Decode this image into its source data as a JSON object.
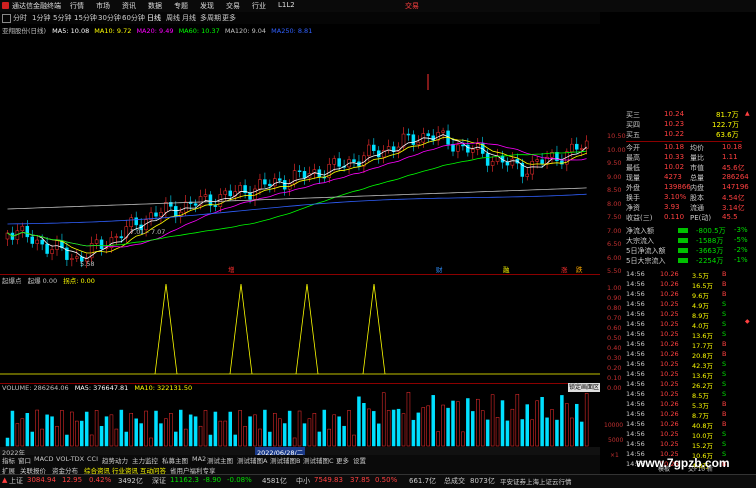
{
  "app": {
    "title": "通达信金融终端",
    "trade_label": "交易",
    "menu": [
      "行情",
      "市场",
      "资讯",
      "数据",
      "专题",
      "发现",
      "交易",
      "行业",
      "L1L2"
    ],
    "periods": [
      "分时",
      "1分钟",
      "5分钟",
      "15分钟",
      "30分钟",
      "60分钟",
      "日线",
      "周线",
      "月线",
      "多周期",
      "更多"
    ]
  },
  "stock": {
    "name_line": "亚翔股份(日线)",
    "ma": [
      {
        "label": "MA5: 10.08",
        "color": "#ffffff"
      },
      {
        "label": "MA10: 9.72",
        "color": "#ffff00"
      },
      {
        "label": "MA20: 9.49",
        "color": "#ff00ff"
      },
      {
        "label": "MA60: 10.37",
        "color": "#00ff00"
      },
      {
        "label": "MA120: 9.04",
        "color": "#c0c0c0"
      },
      {
        "label": "MA250: 8.81",
        "color": "#3060ff"
      }
    ],
    "low_price_label": "5.58",
    "range_label": "7.01 - 7.07"
  },
  "price_axis": [
    "10.50",
    "10.00",
    "9.50",
    "9.00",
    "8.50",
    "8.00",
    "7.50",
    "7.00",
    "6.50",
    "6.00",
    "5.50"
  ],
  "event_markers": [
    {
      "text": "增",
      "color": "#ff3030"
    },
    {
      "text": "财",
      "color": "#3090ff"
    },
    {
      "text": "融",
      "color": "#ffff00"
    },
    {
      "text": "涨",
      "color": "#ff3030"
    },
    {
      "text": "跌",
      "color": "#ffaa00"
    }
  ],
  "indicator": {
    "title": "起爆点",
    "title2": "起爆 0.00",
    "title3": "拐点: 0.00",
    "axis": [
      "1.00",
      "0.90",
      "0.80",
      "0.70",
      "0.60",
      "0.50",
      "0.40",
      "0.30",
      "0.20",
      "0.10",
      "0.00"
    ]
  },
  "volume": {
    "label": "VOLUME: 286264.06",
    "ma5": "MA5: 376647.81",
    "ma10": "MA10: 322131.50",
    "axis": [
      "10000",
      "5000",
      "×1"
    ],
    "lock_btn": "锁定画面区",
    "date_label": "2022年",
    "selected_date": "2022/06/28/二"
  },
  "bottom_tabs": [
    "指标",
    "窗口",
    "MACD",
    "VOL-TDX",
    "CCI",
    "趋势动力",
    "主力监控",
    "私募主图",
    "MA2",
    "测试主图",
    "测试辅图A",
    "测试辅图B",
    "测试辅图C",
    "更多",
    "设置"
  ],
  "bottom_tabs2": [
    "扩展",
    "关联报价",
    "资金分布",
    "综合资讯",
    "行业资讯",
    "互动问答",
    "省用户福利专享"
  ],
  "right_panel": {
    "order_rows": [
      {
        "label": "买三",
        "price": "10.24",
        "vol": "81.7万"
      },
      {
        "label": "买四",
        "price": "10.23",
        "vol": "122.7万"
      },
      {
        "label": "买五",
        "price": "10.22",
        "vol": "63.6万"
      }
    ],
    "stats": [
      {
        "l1": "今开",
        "v1": "10.18",
        "l2": "均价",
        "v2": "10.18"
      },
      {
        "l1": "最高",
        "v1": "10.33",
        "l2": "量比",
        "v2": "1.11"
      },
      {
        "l1": "最低",
        "v1": "10.02",
        "l2": "市值",
        "v2": "45.6亿"
      },
      {
        "l1": "现量",
        "v1": "4273",
        "l2": "总量",
        "v2": "286264"
      },
      {
        "l1": "外盘",
        "v1": "139866",
        "l2": "内盘",
        "v2": "147196"
      },
      {
        "l1": "换手",
        "v1": "3.10%",
        "l2": "股本",
        "v2": "4.54亿"
      },
      {
        "l1": "净资",
        "v1": "3.93",
        "l2": "流通",
        "v2": "3.14亿"
      },
      {
        "l1": "收益(三)",
        "v1": "0.110",
        "l2": "PE(动)",
        "v2": "45.5"
      }
    ],
    "flows": [
      {
        "label": "净流入额",
        "val": "-800.5万",
        "pct": "-3%"
      },
      {
        "label": "大宗流入",
        "val": "-1588万",
        "pct": "-5%"
      },
      {
        "label": "5日净流入额",
        "val": "-3663万",
        "pct": "-2%"
      },
      {
        "label": "5日大宗流入",
        "val": "-2254万",
        "pct": "-1%"
      }
    ],
    "ticks": [
      {
        "t": "14:56",
        "p": "10.26",
        "v": "3.5万",
        "d": "B"
      },
      {
        "t": "14:56",
        "p": "10.26",
        "v": "16.5万",
        "d": "B"
      },
      {
        "t": "14:56",
        "p": "10.26",
        "v": "9.6万",
        "d": "B"
      },
      {
        "t": "14:56",
        "p": "10.25",
        "v": "4.9万",
        "d": "S"
      },
      {
        "t": "14:56",
        "p": "10.25",
        "v": "8.9万",
        "d": "S"
      },
      {
        "t": "14:56",
        "p": "10.25",
        "v": "4.0万",
        "d": "S"
      },
      {
        "t": "14:56",
        "p": "10.25",
        "v": "13.6万",
        "d": "S"
      },
      {
        "t": "14:56",
        "p": "10.26",
        "v": "17.7万",
        "d": "B"
      },
      {
        "t": "14:56",
        "p": "10.26",
        "v": "20.8万",
        "d": "B"
      },
      {
        "t": "14:56",
        "p": "10.25",
        "v": "42.3万",
        "d": "S"
      },
      {
        "t": "14:56",
        "p": "10.25",
        "v": "13.6万",
        "d": "S"
      },
      {
        "t": "14:56",
        "p": "10.25",
        "v": "26.2万",
        "d": "S"
      },
      {
        "t": "14:56",
        "p": "10.25",
        "v": "8.5万",
        "d": "S"
      },
      {
        "t": "14:56",
        "p": "10.26",
        "v": "5.3万",
        "d": "B"
      },
      {
        "t": "14:56",
        "p": "10.26",
        "v": "8.7万",
        "d": "B"
      },
      {
        "t": "14:56",
        "p": "10.26",
        "v": "40.8万",
        "d": "B"
      },
      {
        "t": "14:56",
        "p": "10.25",
        "v": "10.0万",
        "d": "S"
      },
      {
        "t": "14:56",
        "p": "10.25",
        "v": "15.2万",
        "d": "S"
      },
      {
        "t": "14:56",
        "p": "10.25",
        "v": "10.6万",
        "d": "S"
      },
      {
        "t": "14:56",
        "p": "10.26",
        "v": "4.8万",
        "d": "B"
      }
    ],
    "tail_left": "模板",
    "tail_right": "交F10 新"
  },
  "status": {
    "sh_label": "上证",
    "sh_val": "3084.94",
    "sh_chg": "12.95",
    "sh_pct": "0.42%",
    "sh_amt": "3492亿",
    "sz_label": "深证",
    "sz_val": "11162.3",
    "sz_chg": "-8.90",
    "sz_pct": "-0.08%",
    "sz_amt": "4581亿",
    "zx_label": "中小",
    "zx_val": "7549.83",
    "zx_chg": "37.85",
    "zx_pct": "0.50%",
    "zx_amt": "661.7亿",
    "total_label": "总成交",
    "total_val": "8073亿",
    "broker": "平安证券上海上证云行情"
  },
  "watermark": "www.7gpzb.com"
}
